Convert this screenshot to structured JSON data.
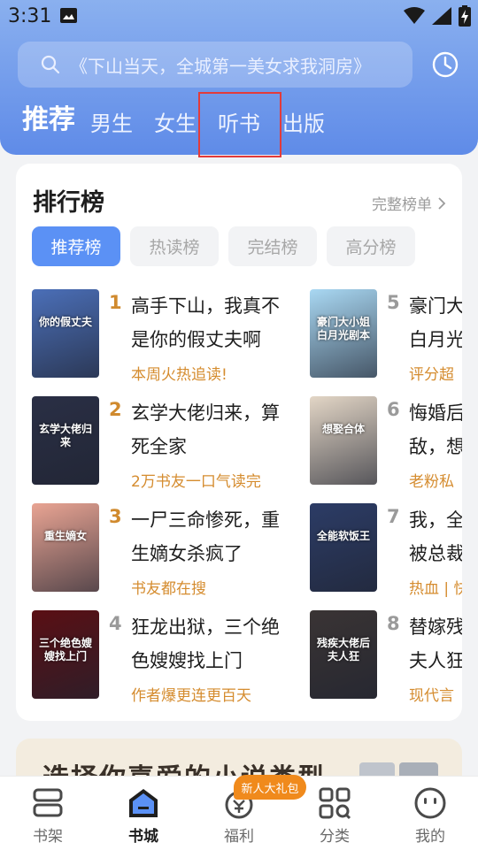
{
  "status_bar": {
    "time": "3:31"
  },
  "search": {
    "placeholder": "《下山当天，全城第一美女求我洞房》"
  },
  "tabs": [
    {
      "label": "推荐",
      "active": true
    },
    {
      "label": "男生",
      "active": false
    },
    {
      "label": "女生",
      "active": false
    },
    {
      "label": "听书",
      "active": false
    },
    {
      "label": "出版",
      "active": false
    }
  ],
  "ranking": {
    "title": "排行榜",
    "full_list_label": "完整榜单",
    "filters": [
      {
        "label": "推荐榜",
        "active": true
      },
      {
        "label": "热读榜",
        "active": false
      },
      {
        "label": "完结榜",
        "active": false
      },
      {
        "label": "高分榜",
        "active": false
      }
    ],
    "books": [
      {
        "rank": "1",
        "title_line1": "高手下山，我真不",
        "title_line2": "是你的假丈夫啊",
        "tag": "本周火热追读!",
        "cover_text": "你的假丈夫",
        "cover_color": "#4b6fb8"
      },
      {
        "rank": "2",
        "title_line1": "玄学大佬归来，算",
        "title_line2": "死全家",
        "tag": "2万书友一口气读完",
        "cover_text": "玄学大佬归来",
        "cover_color": "#2a2f45"
      },
      {
        "rank": "3",
        "title_line1": "一尸三命惨死，重",
        "title_line2": "生嫡女杀疯了",
        "tag": "书友都在搜",
        "cover_text": "重生嫡女",
        "cover_color": "#e9a493"
      },
      {
        "rank": "4",
        "title_line1": "狂龙出狱，三个绝",
        "title_line2": "色嫂嫂找上门",
        "tag": "作者爆更连更百天",
        "cover_text": "三个绝色嫂嫂找上门",
        "cover_color": "#5a0f14"
      },
      {
        "rank": "5",
        "title_line1": "豪门大",
        "title_line2": "白月光",
        "tag": "评分超",
        "cover_text": "豪门大小姐 白月光剧本",
        "cover_color": "#a9d8f3"
      },
      {
        "rank": "6",
        "title_line1": "悔婚后",
        "title_line2": "敌，想",
        "tag": "老粉私",
        "cover_text": "想娶合体",
        "cover_color": "#e3d6c6"
      },
      {
        "rank": "7",
        "title_line1": "我，全",
        "title_line2": "被总裁",
        "tag": "热血 | 快",
        "cover_text": "全能软饭王",
        "cover_color": "#2c3c66"
      },
      {
        "rank": "8",
        "title_line1": "替嫁残",
        "title_line2": "夫人狂",
        "tag": "现代言",
        "cover_text": "残疾大佬后夫人狂",
        "cover_color": "#3a3434"
      }
    ]
  },
  "banner": {
    "text": "选择你喜爱的小说类型"
  },
  "bottom_nav": {
    "badge": "新人大礼包",
    "items": [
      {
        "label": "书架",
        "active": false
      },
      {
        "label": "书城",
        "active": true
      },
      {
        "label": "福利",
        "active": false
      },
      {
        "label": "分类",
        "active": false
      },
      {
        "label": "我的",
        "active": false
      }
    ]
  },
  "colors": {
    "accent": "#5b91f5",
    "rank_top3": "#d08a2e",
    "rank_other": "#9a9a9a",
    "tag": "#d58c2f",
    "highlight_box": "#e23b3b"
  }
}
